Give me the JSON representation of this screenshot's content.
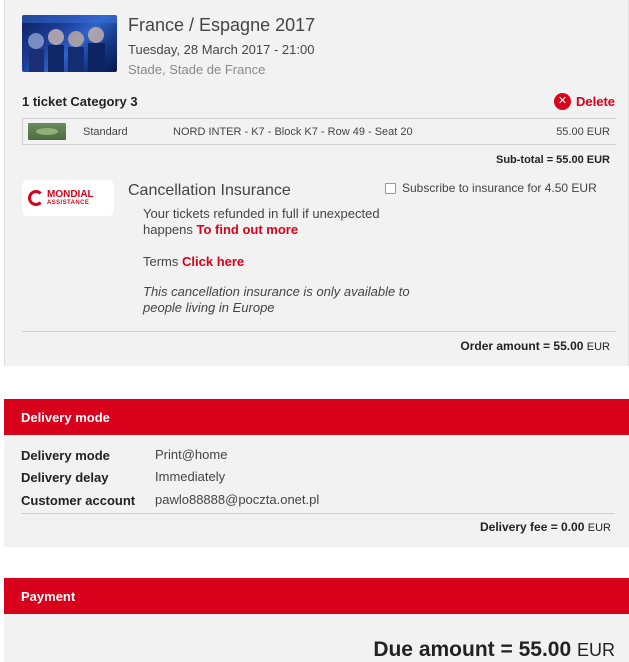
{
  "event": {
    "title": "France / Espagne 2017",
    "date": "Tuesday, 28 March 2017 - 21:00",
    "venue": "Stade, Stade de France"
  },
  "ticket": {
    "count_label": "1 ticket Category 3",
    "delete_label": "Delete",
    "type": "Standard",
    "seat": "NORD INTER - K7 - Block K7 - Row 49 - Seat 20",
    "price": "55.00 EUR",
    "subtotal": "Sub-total = 55.00 EUR"
  },
  "insurance": {
    "logo_main": "MONDIAL",
    "logo_sub": "ASSISTANCE",
    "title": "Cancellation Insurance",
    "subscribe_label": "Subscribe to insurance for 4.50 EUR",
    "text": "Your tickets refunded in full if unexpected happens",
    "text_link": "To find out more",
    "terms_label": "Terms",
    "terms_link": "Click here",
    "note": "This cancellation insurance is only available to people living in Europe"
  },
  "order": {
    "amount_label": "Order amount = 55.00",
    "amount_unit": "EUR"
  },
  "delivery": {
    "header": "Delivery mode",
    "rows": [
      {
        "label": "Delivery mode",
        "value": "Print@home"
      },
      {
        "label": "Delivery delay",
        "value": "Immediately"
      },
      {
        "label": "Customer account",
        "value": "pawlo88888@poczta.onet.pl"
      }
    ],
    "fee_label": "Delivery fee = 0.00",
    "fee_unit": "EUR"
  },
  "payment": {
    "header": "Payment",
    "due_label": "Due amount = 55.00",
    "due_unit": "EUR"
  },
  "colors": {
    "accent": "#d9001b",
    "panel": "#f2f2f2"
  }
}
